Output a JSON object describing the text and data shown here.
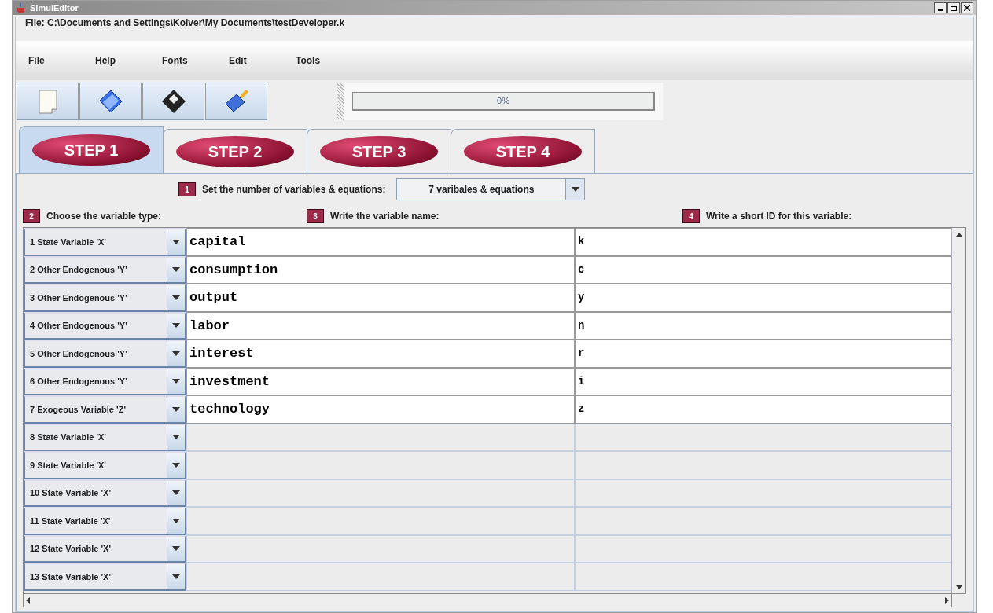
{
  "window": {
    "title": "SimulEditor"
  },
  "file_label": "File:  C:\\Documents and Settings\\Kolver\\My Documents\\testDeveloper.k",
  "menu": [
    "File",
    "Help",
    "Fonts",
    "Edit",
    "Tools"
  ],
  "progress": {
    "label": "0%",
    "level": 0
  },
  "tabs": [
    {
      "label": "STEP  1",
      "selected": true
    },
    {
      "label": "STEP  2",
      "selected": false
    },
    {
      "label": "STEP  3",
      "selected": false
    },
    {
      "label": "STEP  4",
      "selected": false
    }
  ],
  "step1": {
    "badge": "1",
    "label": "Set the number of variables & equations:",
    "value": "7 varibales & equations"
  },
  "headers": [
    {
      "badge": "2",
      "label": "Choose the variable type:"
    },
    {
      "badge": "3",
      "label": "Write the variable name:"
    },
    {
      "badge": "4",
      "label": "Write a short ID for this variable:"
    }
  ],
  "rows": [
    {
      "type": "1 State Variable 'X'",
      "name": "capital",
      "id": "k"
    },
    {
      "type": "2 Other Endogenous 'Y'",
      "name": "consumption",
      "id": "c"
    },
    {
      "type": "3 Other Endogenous 'Y'",
      "name": "output",
      "id": "y"
    },
    {
      "type": "4 Other Endogenous 'Y'",
      "name": "labor",
      "id": "n"
    },
    {
      "type": "5 Other Endogenous 'Y'",
      "name": "interest",
      "id": "r"
    },
    {
      "type": "6 Other Endogenous 'Y'",
      "name": "investment",
      "id": "i"
    },
    {
      "type": "7 Exogeous Variable 'Z'",
      "name": "technology",
      "id": "z"
    },
    {
      "type": "8 State Variable 'X'"
    },
    {
      "type": "9 State Variable 'X'"
    },
    {
      "type": "10 State Variable 'X'"
    },
    {
      "type": "11 State Variable 'X'"
    },
    {
      "type": "12 State Variable 'X'"
    },
    {
      "type": "13 State Variable 'X'"
    }
  ]
}
